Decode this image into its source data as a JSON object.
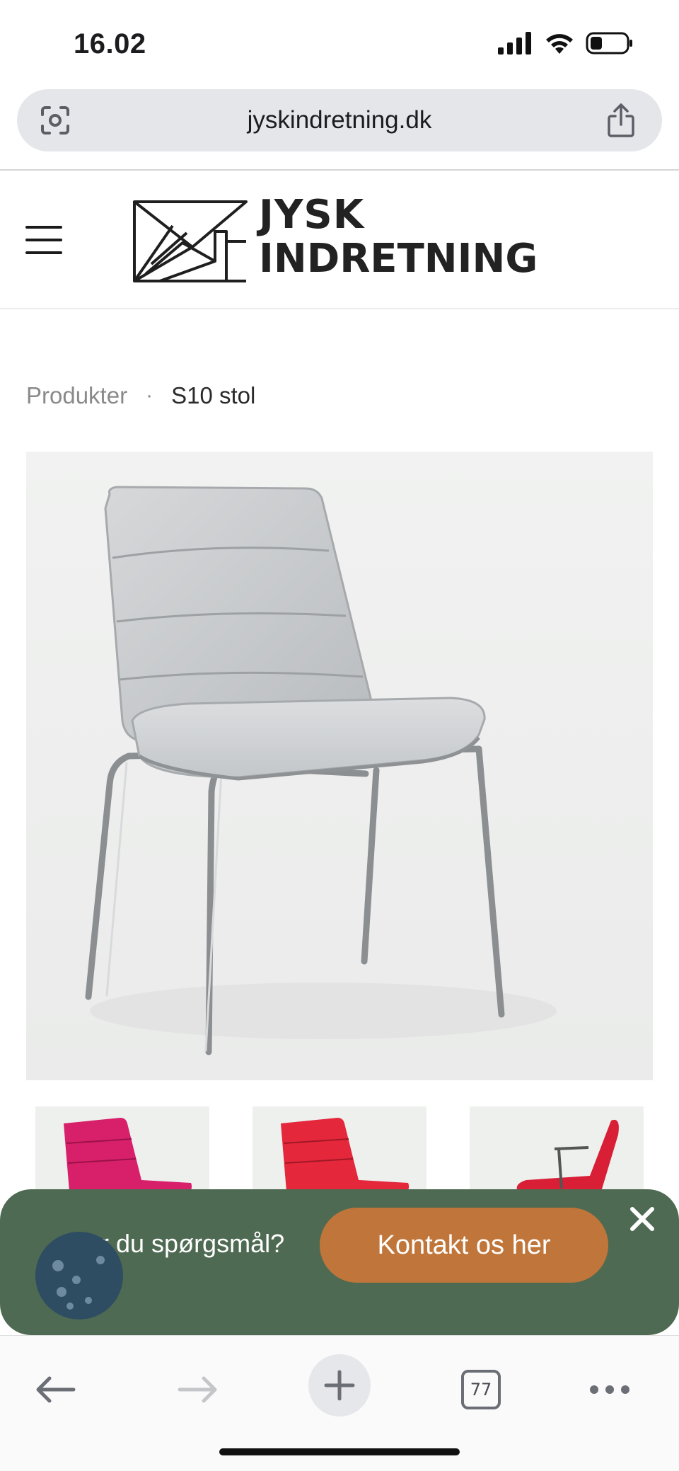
{
  "status_bar": {
    "time": "16.02"
  },
  "browser": {
    "url": "jyskindretning.dk",
    "open_tabs": "77"
  },
  "site": {
    "logo_line1": "JYSK",
    "logo_line2": "INDRETNING"
  },
  "breadcrumb": {
    "parent": "Produkter",
    "separator": "·",
    "current": "S10 stol"
  },
  "product": {
    "thumbnail_colors": [
      "#d8206a",
      "#e4273b",
      "#d81f35"
    ],
    "row2_colors": [
      "#2f5a63",
      "#6b8a2e",
      "#a8b04a"
    ]
  },
  "contact_banner": {
    "question": "Har du spørgsmål?",
    "button_label": "Kontakt os her",
    "background": "#4f6a52",
    "button_color": "#c0763a"
  },
  "icons": {
    "back": "back-arrow-icon",
    "forward": "forward-arrow-icon",
    "new_tab": "plus-icon",
    "more": "more-dots-icon",
    "share": "share-icon",
    "lens": "camera-lens-icon"
  }
}
